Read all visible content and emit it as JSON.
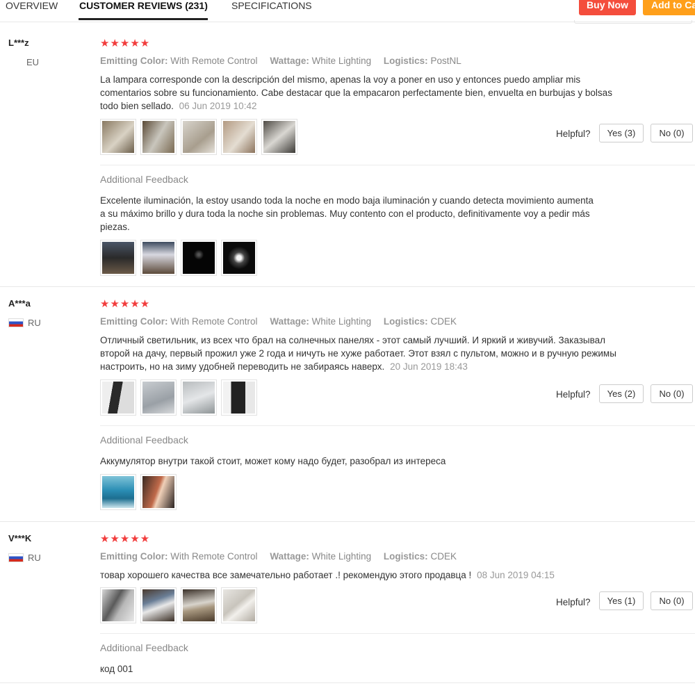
{
  "nav": {
    "tabs": [
      {
        "label": "OVERVIEW"
      },
      {
        "label": "CUSTOMER REVIEWS (231)"
      },
      {
        "label": "SPECIFICATIONS"
      }
    ],
    "buy_now": "Buy Now",
    "add_to_cart": "Add to Ca"
  },
  "reviews": [
    {
      "user": "L***z",
      "country": "EU",
      "stars": "★★★★★",
      "attr1_label": "Emitting Color:",
      "attr1_value": "With Remote Control",
      "attr2_label": "Wattage:",
      "attr2_value": "White Lighting",
      "attr3_label": "Logistics:",
      "attr3_value": "PostNL",
      "text": "La lampara corresponde con la descripción del mismo, apenas la voy a poner en uso y entonces puedo ampliar mis comentarios sobre su funcionamiento. Cabe destacar que la empacaron perfectamente bien, envuelta en burbujas y bolsas todo bien sellado.",
      "date": "06 Jun 2019 10:42",
      "helpful": "Helpful?",
      "yes": "Yes (3)",
      "no": "No (0)",
      "additional_label": "Additional Feedback",
      "additional_text": "Excelente iluminación, la estoy usando toda la noche en modo baja iluminación y cuando detecta movimiento aumenta a su máximo brillo y dura toda la noche sin problemas. Muy contento con el producto, definitivamente voy a pedir más piezas."
    },
    {
      "user": "A***a",
      "country": "RU",
      "stars": "★★★★★",
      "attr1_label": "Emitting Color:",
      "attr1_value": "With Remote Control",
      "attr2_label": "Wattage:",
      "attr2_value": "White Lighting",
      "attr3_label": "Logistics:",
      "attr3_value": "CDEK",
      "text": "Отличный светильник, из всех что брал на солнечных панелях - этот самый лучший. И яркий и живучий. Заказывал второй на дачу, первый прожил уже 2 года и ничуть не хуже работает. Этот взял с пультом, можно и в ручную режимы настроить, но на зиму удобней переводить не забираясь наверх.",
      "date": "20 Jun 2019 18:43",
      "helpful": "Helpful?",
      "yes": "Yes (2)",
      "no": "No (0)",
      "additional_label": "Additional Feedback",
      "additional_text": "Аккумулятор внутри такой стоит, может кому надо будет, разобрал из интереса"
    },
    {
      "user": "V***K",
      "country": "RU",
      "stars": "★★★★★",
      "attr1_label": "Emitting Color:",
      "attr1_value": "With Remote Control",
      "attr2_label": "Wattage:",
      "attr2_value": "White Lighting",
      "attr3_label": "Logistics:",
      "attr3_value": "CDEK",
      "text": "товар хорошего качества все замечательно работает .! рекомендую этого продавца !",
      "date": "08 Jun 2019 04:15",
      "helpful": "Helpful?",
      "yes": "Yes (1)",
      "no": "No (0)",
      "additional_label": "Additional Feedback",
      "additional_text": "код 001"
    }
  ],
  "colors": {
    "star": "#f23d3d",
    "buy_now": "#f44d3c",
    "add_to_cart": "#ff9f1a"
  }
}
